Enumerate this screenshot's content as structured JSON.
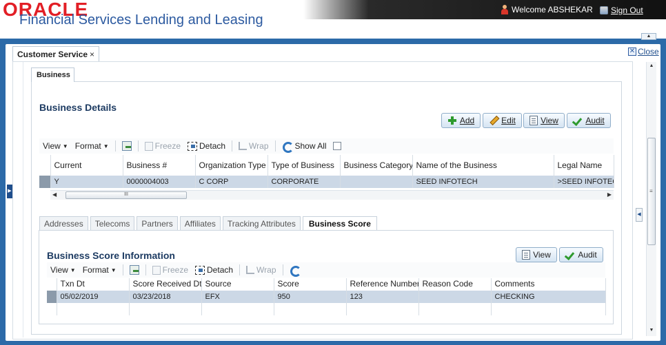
{
  "header": {
    "logo_text": "ORACLE",
    "app_title": "Financial Services Lending and Leasing",
    "welcome_text": "Welcome ABSHEKAR",
    "sign_out_label": "Sign Out"
  },
  "tabs": {
    "main_tab_label": "Customer Service",
    "main_tab_close": "×",
    "close_label": "Close",
    "business_tab_label": "Business"
  },
  "business_details": {
    "title": "Business Details",
    "buttons": {
      "add": "Add",
      "edit": "Edit",
      "view": "View",
      "audit": "Audit"
    },
    "toolbar": {
      "view": "View",
      "format": "Format",
      "freeze": "Freeze",
      "detach": "Detach",
      "wrap": "Wrap",
      "show_all": "Show All"
    },
    "columns": [
      "Current",
      "Business #",
      "Organization Type",
      "Type of Business",
      "Business Category",
      "Name of the Business",
      "Legal Name"
    ],
    "rows": [
      {
        "current": "Y",
        "business_no": "0000004003",
        "org_type": "C CORP",
        "type_of_business": "CORPORATE",
        "category": "",
        "name": "SEED INFOTECH",
        "legal_name": ">SEED INFOTECH"
      }
    ],
    "scroll_thumb": "III"
  },
  "sub_tabs": [
    "Addresses",
    "Telecoms",
    "Partners",
    "Affiliates",
    "Tracking Attributes",
    "Business Score"
  ],
  "business_score": {
    "title": "Business Score Information",
    "buttons": {
      "view": "View",
      "audit": "Audit"
    },
    "toolbar": {
      "view": "View",
      "format": "Format",
      "freeze": "Freeze",
      "detach": "Detach",
      "wrap": "Wrap"
    },
    "columns": [
      "Txn Dt",
      "Score Received Dt",
      "Source",
      "Score",
      "Reference Number",
      "Reason Code",
      "Comments"
    ],
    "rows": [
      {
        "txn_dt": "05/02/2019",
        "received_dt": "03/23/2018",
        "source": "EFX",
        "score": "950",
        "ref": "123",
        "reason": "",
        "comments": "CHECKING"
      }
    ]
  },
  "colors": {
    "brand_red": "#e21f26",
    "title_blue": "#2c5aa0",
    "frame_blue": "#2c6aa8",
    "selected_row": "#ccd8e6"
  }
}
